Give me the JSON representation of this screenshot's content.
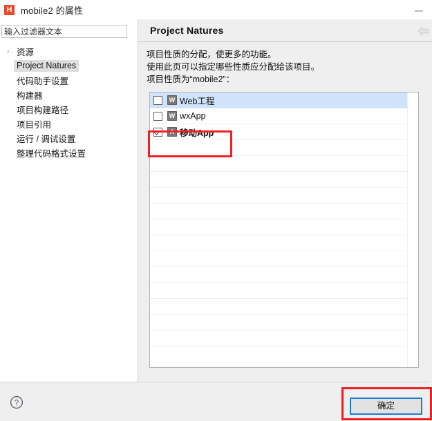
{
  "window": {
    "title": "mobile2 的属性",
    "app_icon_letter": "H",
    "app_icon_color": "#e8492b",
    "minimize_label": "—"
  },
  "sidebar": {
    "filter": {
      "placeholder": "输入过滤器文本",
      "value": ""
    },
    "items": [
      {
        "label": "资源",
        "chevron": "›",
        "expandable": true,
        "selected": false,
        "indent": 0
      },
      {
        "label": "Project Natures",
        "chevron": "",
        "expandable": false,
        "selected": true,
        "indent": 1
      },
      {
        "label": "代码助手设置",
        "chevron": "",
        "expandable": false,
        "selected": false,
        "indent": 1
      },
      {
        "label": "构建器",
        "chevron": "",
        "expandable": false,
        "selected": false,
        "indent": 1
      },
      {
        "label": "项目构建路径",
        "chevron": "",
        "expandable": false,
        "selected": false,
        "indent": 1
      },
      {
        "label": "项目引用",
        "chevron": "",
        "expandable": false,
        "selected": false,
        "indent": 1
      },
      {
        "label": "运行 / 调试设置",
        "chevron": "",
        "expandable": false,
        "selected": false,
        "indent": 1
      },
      {
        "label": "整理代码格式设置",
        "chevron": "",
        "expandable": false,
        "selected": false,
        "indent": 1
      }
    ]
  },
  "panel": {
    "title": "Project Natures",
    "back_icon": "back-arrow-icon",
    "description_lines": [
      "项目性质的分配，使更多的功能。",
      "使用此页可以指定哪些性质应分配给该项目。",
      "项目性质为“mobile2”："
    ],
    "natures": [
      {
        "label": "Web工程",
        "icon_letter": "W",
        "checked": false,
        "selected": true,
        "bold": false
      },
      {
        "label": "wxApp",
        "icon_letter": "W",
        "checked": false,
        "selected": false,
        "bold": false
      },
      {
        "label": "移动App",
        "icon_letter": "A",
        "checked": true,
        "selected": false,
        "bold": true
      }
    ],
    "blank_row_count": 15
  },
  "footer": {
    "help_icon": "help-question-icon",
    "ok_label": "确定"
  },
  "annotations": {
    "color": "#ee2024",
    "boxes": [
      {
        "name": "nature-mobile-app-highlight"
      },
      {
        "name": "ok-button-highlight"
      }
    ]
  }
}
